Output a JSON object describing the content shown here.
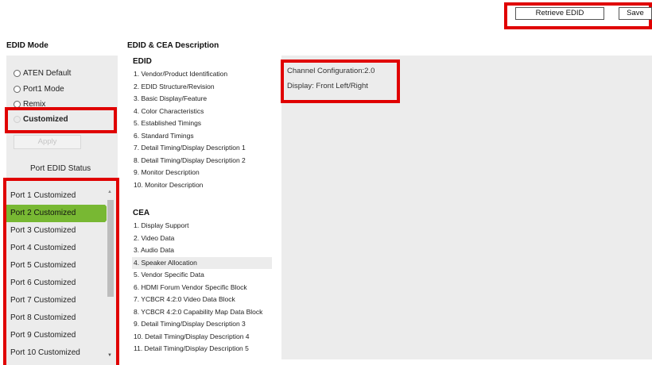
{
  "toolbar": {
    "retrieve_label": "Retrieve EDID",
    "save_label": "Save"
  },
  "edid_mode": {
    "title": "EDID Mode",
    "options": [
      {
        "label": "ATEN Default",
        "selected": false
      },
      {
        "label": "Port1 Mode",
        "selected": false
      },
      {
        "label": "Remix",
        "selected": false
      },
      {
        "label": "Customized",
        "selected": true
      }
    ],
    "apply_label": "Apply",
    "status_title": "Port EDID Status",
    "ports": [
      "Port 1  Customized",
      "Port 2  Customized",
      "Port 3  Customized",
      "Port 4  Customized",
      "Port 5  Customized",
      "Port 6  Customized",
      "Port 7  Customized",
      "Port 8  Customized",
      "Port 9  Customized",
      "Port 10  Customized"
    ],
    "active_port_index": 1
  },
  "description": {
    "title": "EDID & CEA Description",
    "edid_header": "EDID",
    "edid_items": [
      "1.  Vendor/Product Identification",
      "2.  EDID Structure/Revision",
      "3.  Basic Display/Feature",
      "4.  Color Characteristics",
      "5.  Established Timings",
      "6.  Standard Timings",
      "7.  Detail Timing/Display Description 1",
      "8.  Detail Timing/Display Description 2",
      "9.  Monitor Description",
      "10.   Monitor Description"
    ],
    "cea_header": "CEA",
    "cea_items": [
      "1.  Display Support",
      "2.  Video Data",
      "3.  Audio Data",
      "4.  Speaker Allocation",
      "5.  Vendor Specific Data",
      "6.  HDMI Forum Vendor Specific Block",
      "7.  YCBCR 4:2:0 Video Data Block",
      "8.  YCBCR 4:2:0 Capability Map Data Block",
      "9.  Detail Timing/Display Description 3",
      "10.   Detail Timing/Display Description 4",
      "11.   Detail Timing/Display Description 5"
    ],
    "selected_cea_index": 3
  },
  "detail": {
    "line1": "Channel Configuration:2.0",
    "line2": "Display: Front Left/Right"
  },
  "colors": {
    "highlight": "#e00000",
    "active_port": "#78b833",
    "panel_bg": "#ececec"
  }
}
